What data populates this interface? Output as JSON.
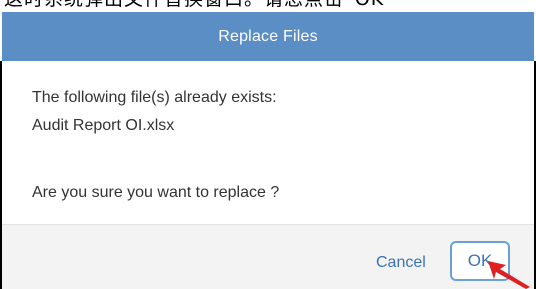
{
  "overlay": {
    "top_text": "这时系统弹出文件替换窗口。请您点击“OK”"
  },
  "dialog": {
    "title": "Replace Files",
    "message_line_1": "The following file(s) already exists:",
    "file_name": "Audit Report OI.xlsx",
    "confirm_question": "Are you sure you want to replace ?",
    "cancel_label": "Cancel",
    "ok_label": "OK"
  },
  "colors": {
    "titlebar": "#5b8ec4",
    "button_text": "#3d73b5",
    "ok_border": "#6a9fd8",
    "footer_bg": "#f3f3f3",
    "annotation_arrow": "#e02020"
  },
  "icons": {
    "annotation": "red-pointer-arrow-icon"
  }
}
